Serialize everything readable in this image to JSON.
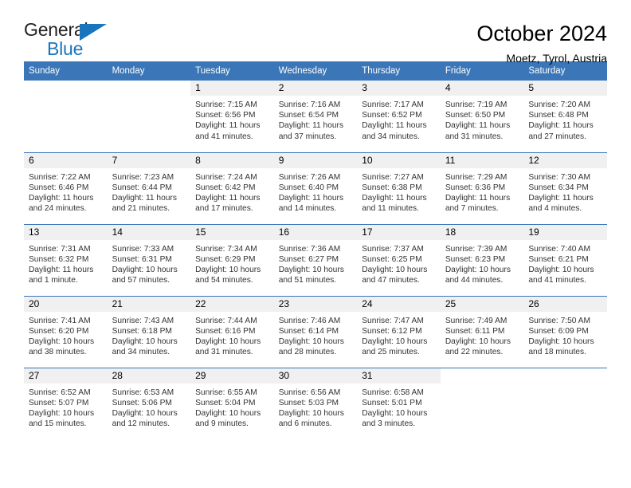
{
  "brand": {
    "name_top": "General",
    "name_bottom": "Blue",
    "accent_color": "#1b75bc"
  },
  "header": {
    "title": "October 2024",
    "subtitle": "Moetz, Tyrol, Austria"
  },
  "theme": {
    "header_row_bg": "#3a76b8",
    "daynum_bg": "#f0f0f0",
    "text_color": "#333333"
  },
  "weekday_headers": [
    "Sunday",
    "Monday",
    "Tuesday",
    "Wednesday",
    "Thursday",
    "Friday",
    "Saturday"
  ],
  "weeks": [
    [
      {
        "day": "",
        "sunrise": "",
        "sunset": "",
        "daylight_line1": "",
        "daylight_line2": ""
      },
      {
        "day": "",
        "sunrise": "",
        "sunset": "",
        "daylight_line1": "",
        "daylight_line2": ""
      },
      {
        "day": "1",
        "sunrise": "Sunrise: 7:15 AM",
        "sunset": "Sunset: 6:56 PM",
        "daylight_line1": "Daylight: 11 hours",
        "daylight_line2": "and 41 minutes."
      },
      {
        "day": "2",
        "sunrise": "Sunrise: 7:16 AM",
        "sunset": "Sunset: 6:54 PM",
        "daylight_line1": "Daylight: 11 hours",
        "daylight_line2": "and 37 minutes."
      },
      {
        "day": "3",
        "sunrise": "Sunrise: 7:17 AM",
        "sunset": "Sunset: 6:52 PM",
        "daylight_line1": "Daylight: 11 hours",
        "daylight_line2": "and 34 minutes."
      },
      {
        "day": "4",
        "sunrise": "Sunrise: 7:19 AM",
        "sunset": "Sunset: 6:50 PM",
        "daylight_line1": "Daylight: 11 hours",
        "daylight_line2": "and 31 minutes."
      },
      {
        "day": "5",
        "sunrise": "Sunrise: 7:20 AM",
        "sunset": "Sunset: 6:48 PM",
        "daylight_line1": "Daylight: 11 hours",
        "daylight_line2": "and 27 minutes."
      }
    ],
    [
      {
        "day": "6",
        "sunrise": "Sunrise: 7:22 AM",
        "sunset": "Sunset: 6:46 PM",
        "daylight_line1": "Daylight: 11 hours",
        "daylight_line2": "and 24 minutes."
      },
      {
        "day": "7",
        "sunrise": "Sunrise: 7:23 AM",
        "sunset": "Sunset: 6:44 PM",
        "daylight_line1": "Daylight: 11 hours",
        "daylight_line2": "and 21 minutes."
      },
      {
        "day": "8",
        "sunrise": "Sunrise: 7:24 AM",
        "sunset": "Sunset: 6:42 PM",
        "daylight_line1": "Daylight: 11 hours",
        "daylight_line2": "and 17 minutes."
      },
      {
        "day": "9",
        "sunrise": "Sunrise: 7:26 AM",
        "sunset": "Sunset: 6:40 PM",
        "daylight_line1": "Daylight: 11 hours",
        "daylight_line2": "and 14 minutes."
      },
      {
        "day": "10",
        "sunrise": "Sunrise: 7:27 AM",
        "sunset": "Sunset: 6:38 PM",
        "daylight_line1": "Daylight: 11 hours",
        "daylight_line2": "and 11 minutes."
      },
      {
        "day": "11",
        "sunrise": "Sunrise: 7:29 AM",
        "sunset": "Sunset: 6:36 PM",
        "daylight_line1": "Daylight: 11 hours",
        "daylight_line2": "and 7 minutes."
      },
      {
        "day": "12",
        "sunrise": "Sunrise: 7:30 AM",
        "sunset": "Sunset: 6:34 PM",
        "daylight_line1": "Daylight: 11 hours",
        "daylight_line2": "and 4 minutes."
      }
    ],
    [
      {
        "day": "13",
        "sunrise": "Sunrise: 7:31 AM",
        "sunset": "Sunset: 6:32 PM",
        "daylight_line1": "Daylight: 11 hours",
        "daylight_line2": "and 1 minute."
      },
      {
        "day": "14",
        "sunrise": "Sunrise: 7:33 AM",
        "sunset": "Sunset: 6:31 PM",
        "daylight_line1": "Daylight: 10 hours",
        "daylight_line2": "and 57 minutes."
      },
      {
        "day": "15",
        "sunrise": "Sunrise: 7:34 AM",
        "sunset": "Sunset: 6:29 PM",
        "daylight_line1": "Daylight: 10 hours",
        "daylight_line2": "and 54 minutes."
      },
      {
        "day": "16",
        "sunrise": "Sunrise: 7:36 AM",
        "sunset": "Sunset: 6:27 PM",
        "daylight_line1": "Daylight: 10 hours",
        "daylight_line2": "and 51 minutes."
      },
      {
        "day": "17",
        "sunrise": "Sunrise: 7:37 AM",
        "sunset": "Sunset: 6:25 PM",
        "daylight_line1": "Daylight: 10 hours",
        "daylight_line2": "and 47 minutes."
      },
      {
        "day": "18",
        "sunrise": "Sunrise: 7:39 AM",
        "sunset": "Sunset: 6:23 PM",
        "daylight_line1": "Daylight: 10 hours",
        "daylight_line2": "and 44 minutes."
      },
      {
        "day": "19",
        "sunrise": "Sunrise: 7:40 AM",
        "sunset": "Sunset: 6:21 PM",
        "daylight_line1": "Daylight: 10 hours",
        "daylight_line2": "and 41 minutes."
      }
    ],
    [
      {
        "day": "20",
        "sunrise": "Sunrise: 7:41 AM",
        "sunset": "Sunset: 6:20 PM",
        "daylight_line1": "Daylight: 10 hours",
        "daylight_line2": "and 38 minutes."
      },
      {
        "day": "21",
        "sunrise": "Sunrise: 7:43 AM",
        "sunset": "Sunset: 6:18 PM",
        "daylight_line1": "Daylight: 10 hours",
        "daylight_line2": "and 34 minutes."
      },
      {
        "day": "22",
        "sunrise": "Sunrise: 7:44 AM",
        "sunset": "Sunset: 6:16 PM",
        "daylight_line1": "Daylight: 10 hours",
        "daylight_line2": "and 31 minutes."
      },
      {
        "day": "23",
        "sunrise": "Sunrise: 7:46 AM",
        "sunset": "Sunset: 6:14 PM",
        "daylight_line1": "Daylight: 10 hours",
        "daylight_line2": "and 28 minutes."
      },
      {
        "day": "24",
        "sunrise": "Sunrise: 7:47 AM",
        "sunset": "Sunset: 6:12 PM",
        "daylight_line1": "Daylight: 10 hours",
        "daylight_line2": "and 25 minutes."
      },
      {
        "day": "25",
        "sunrise": "Sunrise: 7:49 AM",
        "sunset": "Sunset: 6:11 PM",
        "daylight_line1": "Daylight: 10 hours",
        "daylight_line2": "and 22 minutes."
      },
      {
        "day": "26",
        "sunrise": "Sunrise: 7:50 AM",
        "sunset": "Sunset: 6:09 PM",
        "daylight_line1": "Daylight: 10 hours",
        "daylight_line2": "and 18 minutes."
      }
    ],
    [
      {
        "day": "27",
        "sunrise": "Sunrise: 6:52 AM",
        "sunset": "Sunset: 5:07 PM",
        "daylight_line1": "Daylight: 10 hours",
        "daylight_line2": "and 15 minutes."
      },
      {
        "day": "28",
        "sunrise": "Sunrise: 6:53 AM",
        "sunset": "Sunset: 5:06 PM",
        "daylight_line1": "Daylight: 10 hours",
        "daylight_line2": "and 12 minutes."
      },
      {
        "day": "29",
        "sunrise": "Sunrise: 6:55 AM",
        "sunset": "Sunset: 5:04 PM",
        "daylight_line1": "Daylight: 10 hours",
        "daylight_line2": "and 9 minutes."
      },
      {
        "day": "30",
        "sunrise": "Sunrise: 6:56 AM",
        "sunset": "Sunset: 5:03 PM",
        "daylight_line1": "Daylight: 10 hours",
        "daylight_line2": "and 6 minutes."
      },
      {
        "day": "31",
        "sunrise": "Sunrise: 6:58 AM",
        "sunset": "Sunset: 5:01 PM",
        "daylight_line1": "Daylight: 10 hours",
        "daylight_line2": "and 3 minutes."
      },
      {
        "day": "",
        "sunrise": "",
        "sunset": "",
        "daylight_line1": "",
        "daylight_line2": ""
      },
      {
        "day": "",
        "sunrise": "",
        "sunset": "",
        "daylight_line1": "",
        "daylight_line2": ""
      }
    ]
  ]
}
